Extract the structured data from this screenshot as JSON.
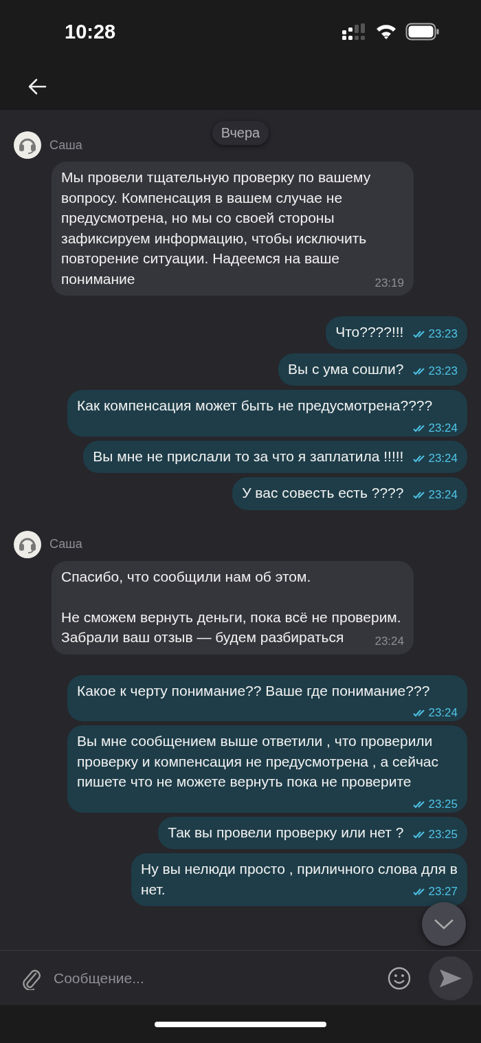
{
  "status_bar": {
    "time": "10:28"
  },
  "messages": [
    {
      "kind": "date",
      "text": "Вчера"
    },
    {
      "kind": "incoming",
      "sender": "Саша",
      "text": "Мы провели тщательную проверку по вашему вопросу. Компенсация в вашем случае не предусмотрена, но мы со своей стороны зафиксируем информацию, чтобы исключить повторение ситуации. Надеемся на ваше понимание",
      "time": "23:19"
    },
    {
      "kind": "outgoing",
      "text": "Что????!!!",
      "time": "23:23",
      "read": true
    },
    {
      "kind": "outgoing",
      "text": "Вы с ума сошли?",
      "time": "23:23",
      "read": true
    },
    {
      "kind": "outgoing",
      "text": "Как компенсация может быть не предусмотрена????",
      "time": "23:24",
      "read": true
    },
    {
      "kind": "outgoing",
      "text": "Вы мне не прислали то за что я заплатила !!!!!",
      "time": "23:24",
      "read": true
    },
    {
      "kind": "outgoing",
      "text": "У вас совесть есть ????",
      "time": "23:24",
      "read": true
    },
    {
      "kind": "incoming",
      "sender": "Саша",
      "text": "Спасибо, что сообщили нам об этом.\n\nНе сможем вернуть деньги, пока всё не проверим. Забрали ваш отзыв —  будем разбираться",
      "time": "23:24"
    },
    {
      "kind": "outgoing",
      "text": "Какое к черту понимание?? Ваше где понимание???",
      "time": "23:24",
      "read": true
    },
    {
      "kind": "outgoing",
      "text": "Вы мне сообщением выше ответили , что проверили проверку и компенсация не предусмотрена , а сейчас пишете что не можете вернуть пока не проверите",
      "time": "23:25",
      "read": true
    },
    {
      "kind": "outgoing",
      "text": "Так вы провели проверку или нет ?",
      "time": "23:25",
      "read": true
    },
    {
      "kind": "outgoing",
      "text": "Ну вы нелюди просто , приличного слова для в\nнет.",
      "time": "23:27",
      "read": true
    }
  ],
  "composer": {
    "placeholder": "Сообщение..."
  }
}
